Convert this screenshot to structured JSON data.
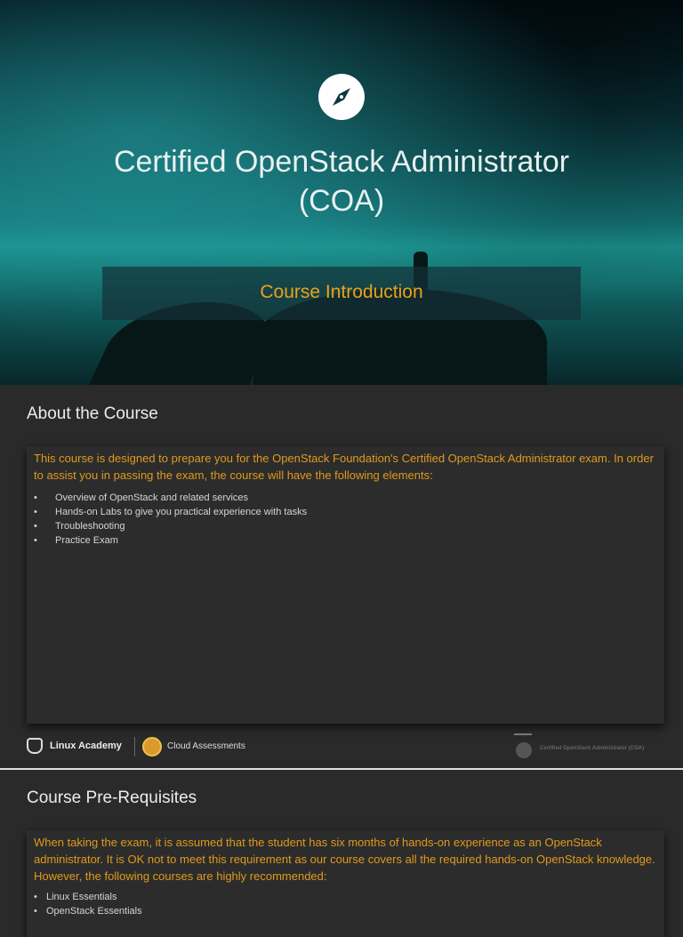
{
  "slide1": {
    "title_line1": "Certified OpenStack Administrator",
    "title_line2": "(COA)",
    "subtitle": "Course Introduction"
  },
  "slide2": {
    "heading": "About the Course",
    "intro": "This course is designed to prepare you for the OpenStack Foundation's Certified OpenStack Administrator exam. In order to assist you in passing the exam, the course will have the following elements:",
    "items": [
      "Overview of OpenStack and related services",
      "Hands-on Labs to give you practical experience with tasks",
      "Troubleshooting",
      "Practice Exam"
    ]
  },
  "footer": {
    "brand1": "Linux Academy",
    "brand2": "Cloud Assessments",
    "course": "Certified OpenStack Administrator (COA)"
  },
  "slide3": {
    "heading": "Course Pre-Requisites",
    "intro": "When taking the exam, it is assumed that the student has six months of hands-on experience as an OpenStack administrator. It is OK not to meet this requirement as our course covers all the required hands-on OpenStack knowledge. However, the following courses are highly recommended:",
    "items": [
      "Linux Essentials",
      "OpenStack Essentials"
    ]
  }
}
